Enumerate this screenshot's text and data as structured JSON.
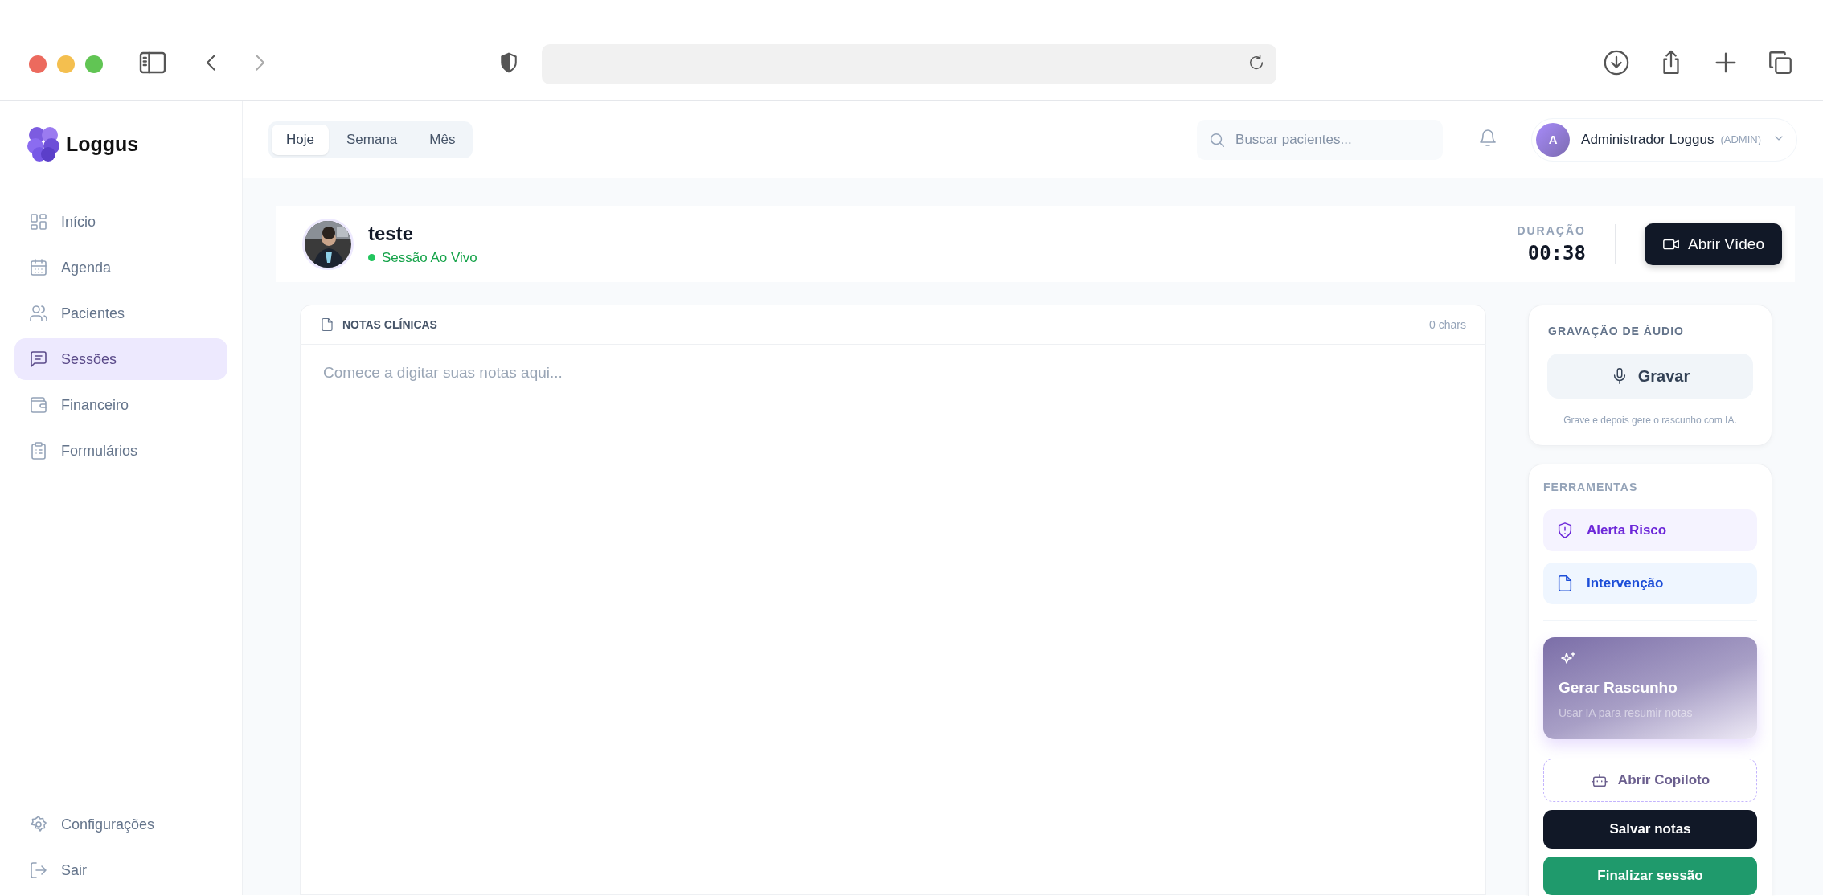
{
  "sidebar": {
    "logo": "Loggus",
    "items": [
      {
        "label": "Início",
        "selected": false
      },
      {
        "label": "Agenda",
        "selected": false
      },
      {
        "label": "Pacientes",
        "selected": false
      },
      {
        "label": "Sessões",
        "selected": true
      },
      {
        "label": "Financeiro",
        "selected": false
      },
      {
        "label": "Formulários",
        "selected": false
      }
    ],
    "footer_items": [
      {
        "label": "Configurações"
      },
      {
        "label": "Sair"
      }
    ]
  },
  "header": {
    "periods": [
      {
        "label": "Hoje",
        "selected": true
      },
      {
        "label": "Semana",
        "selected": false
      },
      {
        "label": "Mês",
        "selected": false
      }
    ],
    "search": {
      "placeholder": "Buscar pacientes..."
    },
    "user": {
      "initial": "A",
      "name": "Administrador Loggus",
      "role": "(ADMIN)"
    }
  },
  "session": {
    "patient": "teste",
    "status": "Sessão Ao Vivo",
    "live": true,
    "duration_label": "DURAÇÃO",
    "duration": "00:38",
    "video_button": "Abrir Vídeo"
  },
  "notes": {
    "title": "NOTAS CLÍNICAS",
    "count": "0 chars",
    "placeholder": "Comece a digitar suas notas aqui..."
  },
  "audio": {
    "title": "GRAVAÇÃO DE ÁUDIO",
    "record_button": "Gravar",
    "hint": "Grave e depois gere o rascunho com IA."
  },
  "tools": {
    "title": "FERRAMENTAS",
    "items": [
      {
        "label": "Alerta Risco",
        "kind": "risk"
      },
      {
        "label": "Intervenção",
        "kind": "intervention"
      }
    ],
    "draft": {
      "title": "Gerar Rascunho",
      "subtitle": "Usar IA para resumir notas"
    },
    "copilot_button": "Abrir Copiloto",
    "save_button": "Salvar notas",
    "finish_button": "Finalizar sessão"
  }
}
